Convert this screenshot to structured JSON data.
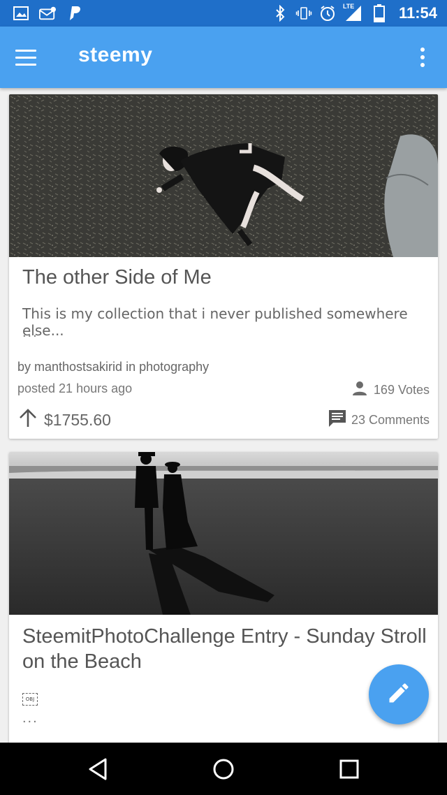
{
  "status_bar": {
    "time": "11:54",
    "network_label": "LTE",
    "icons": [
      "image-icon",
      "mail-icon",
      "paypal-icon",
      "bluetooth-icon",
      "vibrate-icon",
      "alarm-icon",
      "signal-icon",
      "battery-icon"
    ]
  },
  "app_bar": {
    "title": "steemy",
    "menu_icon": "hamburger-menu-icon",
    "overflow_icon": "more-vert-icon"
  },
  "posts": [
    {
      "title": "The other Side of Me",
      "excerpt": "This is my collection that i never published somewhere else...",
      "ellipsis": "...",
      "author_line": "by manthostsakirid in photography",
      "posted": "posted 21 hours ago",
      "votes": "169 Votes",
      "payout": "$1755.60",
      "comments": "23 Comments"
    },
    {
      "title": "SteemitPhotoChallenge Entry - Sunday Stroll on the Beach",
      "obj_placeholder": "OBJ",
      "ellipsis": "..."
    }
  ],
  "fab": {
    "icon": "edit-pencil-icon"
  },
  "nav_bar": {
    "icons": [
      "back-icon",
      "home-icon",
      "recents-icon"
    ]
  },
  "colors": {
    "status_bar": "#1f6fc9",
    "app_bar": "#4aa1f0",
    "fab": "#4aa1f0",
    "background": "#f0f0f0"
  }
}
